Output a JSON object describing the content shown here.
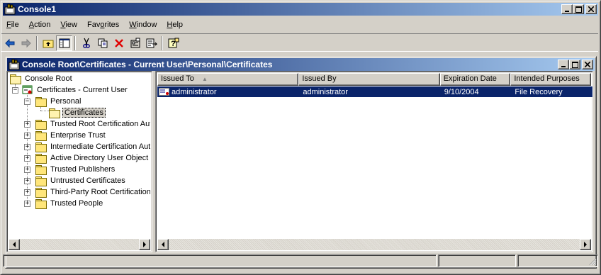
{
  "window": {
    "title": "Console1"
  },
  "menu": [
    {
      "pre": "",
      "key": "F",
      "post": "ile"
    },
    {
      "pre": "",
      "key": "A",
      "post": "ction"
    },
    {
      "pre": "",
      "key": "V",
      "post": "iew"
    },
    {
      "pre": "Fav",
      "key": "o",
      "post": "rites"
    },
    {
      "pre": "",
      "key": "W",
      "post": "indow"
    },
    {
      "pre": "",
      "key": "H",
      "post": "elp"
    }
  ],
  "toolbar": {
    "icons": [
      "back-arrow-icon",
      "forward-arrow-icon",
      "up-one-level-icon",
      "show-hide-tree-icon",
      "cut-icon",
      "copy-icon",
      "delete-icon",
      "properties-icon",
      "export-list-icon",
      "help-icon"
    ]
  },
  "child_window": {
    "title": "Console Root\\Certificates - Current User\\Personal\\Certificates"
  },
  "tree": {
    "root": "Console Root",
    "store": "Certificates - Current User",
    "personal": "Personal",
    "certificates": "Certificates",
    "items": [
      "Trusted Root Certification Aut",
      "Enterprise Trust",
      "Intermediate Certification Aut",
      "Active Directory User Object",
      "Trusted Publishers",
      "Untrusted Certificates",
      "Third-Party Root Certification",
      "Trusted People"
    ]
  },
  "list": {
    "columns": [
      "Issued To",
      "Issued By",
      "Expiration Date",
      "Intended Purposes"
    ],
    "sort_indicator": "▲",
    "rows": [
      {
        "issued_to": "administrator",
        "issued_by": "administrator",
        "expiration": "9/10/2004",
        "purposes": "File Recovery"
      }
    ]
  },
  "colors": {
    "selection": "#0a246a",
    "title_gradient_start": "#0a246a",
    "title_gradient_end": "#a6caf0"
  }
}
